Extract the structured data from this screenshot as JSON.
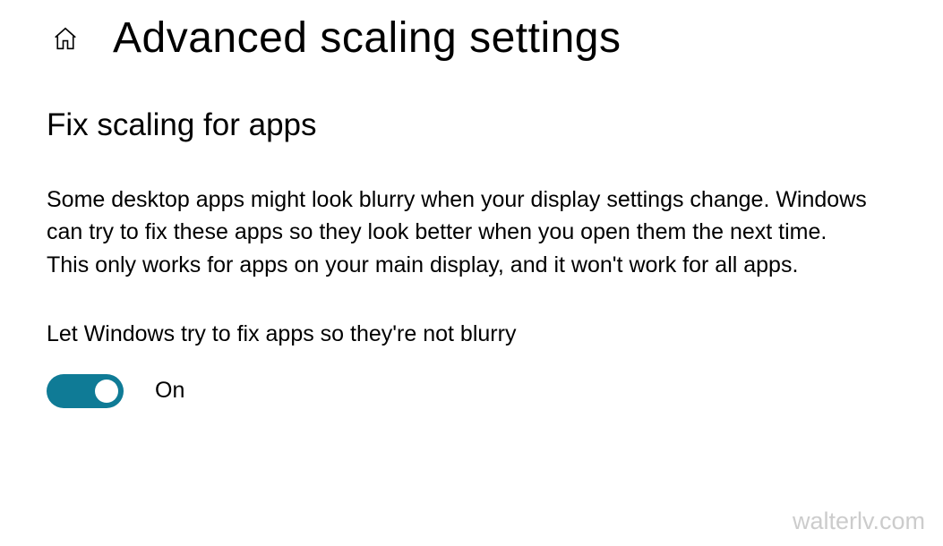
{
  "header": {
    "title": "Advanced scaling settings"
  },
  "section": {
    "heading": "Fix scaling for apps",
    "description": "Some desktop apps might look blurry when your display settings change. Windows can try to fix these apps so they look better when you open them the next time. This only works for apps on your main display, and it won't work for all apps.",
    "toggle": {
      "label": "Let Windows try to fix apps so they're not blurry",
      "state": "On",
      "enabled": true
    }
  },
  "watermark": "walterlv.com",
  "colors": {
    "toggle_accent": "#0f7b96"
  }
}
